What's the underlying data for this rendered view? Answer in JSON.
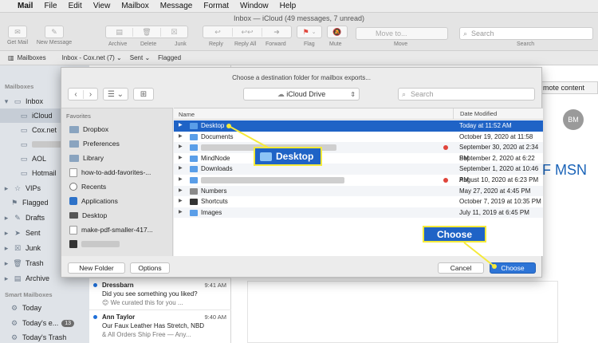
{
  "menubar": {
    "app": "Mail",
    "items": [
      "File",
      "Edit",
      "View",
      "Mailbox",
      "Message",
      "Format",
      "Window",
      "Help"
    ]
  },
  "window": {
    "title": "Inbox — iCloud (49 messages, 7 unread)"
  },
  "toolbar": {
    "get_mail": "Get Mail",
    "new_message": "New Message",
    "archive": "Archive",
    "delete": "Delete",
    "junk": "Junk",
    "reply": "Reply",
    "reply_all": "Reply All",
    "forward": "Forward",
    "flag": "Flag",
    "mute": "Mute",
    "move_placeholder": "Move to...",
    "move": "Move",
    "search_placeholder": "Search",
    "search": "Search"
  },
  "favbar": [
    "Mailboxes",
    "Inbox - Cox.net (7) ⌄",
    "Sent ⌄",
    "Flagged"
  ],
  "sidebar": {
    "mailboxes_head": "Mailboxes",
    "inbox": "Inbox",
    "accounts": [
      "iCloud",
      "Cox.net",
      "",
      "AOL",
      "Hotmail"
    ],
    "vips": "VIPs",
    "flagged": "Flagged",
    "drafts": "Drafts",
    "sent": "Sent",
    "junk": "Junk",
    "trash": "Trash",
    "archive": "Archive",
    "smart_head": "Smart Mailboxes",
    "today": "Today",
    "todays_e": "Today's e...",
    "todays_e_count": "13",
    "todays_trash": "Today's Trash"
  },
  "messages": [
    {
      "from": "Dressbarn",
      "time": "9:41 AM",
      "subject": "Did you see something you liked?",
      "preview": "😊 We curated this for you ..."
    },
    {
      "from": "Ann Taylor",
      "time": "9:40 AM",
      "subject": "Our Faux Leather Has Stretch, NBD",
      "preview": "& All Orders Ship Free — Any..."
    }
  ],
  "content": {
    "remote_button": "mote content",
    "avatar_initials": "BM",
    "heading_fragment": "F MSN"
  },
  "dialog": {
    "title": "Choose a destination folder for mailbox exports...",
    "location": "iCloud Drive",
    "search_placeholder": "Search",
    "favorites_head": "Favorites",
    "favorites": [
      "Dropbox",
      "Preferences",
      "Library",
      "how-to-add-favorites-...",
      "Recents",
      "Applications",
      "Desktop",
      "make-pdf-smaller-417...",
      ""
    ],
    "col_name": "Name",
    "col_date": "Date Modified",
    "files": [
      {
        "name": "Desktop",
        "date": "Today at 11:52 AM"
      },
      {
        "name": "Documents",
        "date": "October 19, 2020 at 11:58 PM"
      },
      {
        "name": "",
        "date": "September 30, 2020 at 2:34 PM"
      },
      {
        "name": "MindNode",
        "date": "September 2, 2020 at 6:22 PM"
      },
      {
        "name": "Downloads",
        "date": "September 1, 2020 at 10:46 PM"
      },
      {
        "name": "",
        "date": "August 10, 2020 at 6:23 PM"
      },
      {
        "name": "Numbers",
        "date": "May 27, 2020 at 4:45 PM"
      },
      {
        "name": "Shortcuts",
        "date": "October 7, 2019 at 10:35 PM"
      },
      {
        "name": "Images",
        "date": "July 11, 2019 at 6:45 PM"
      }
    ],
    "new_folder": "New Folder",
    "options": "Options",
    "cancel": "Cancel",
    "choose": "Choose"
  },
  "callouts": {
    "desktop": "Desktop",
    "choose": "Choose"
  },
  "colors": {
    "accent": "#1f63c6",
    "callout_border": "#f5ea3a"
  }
}
